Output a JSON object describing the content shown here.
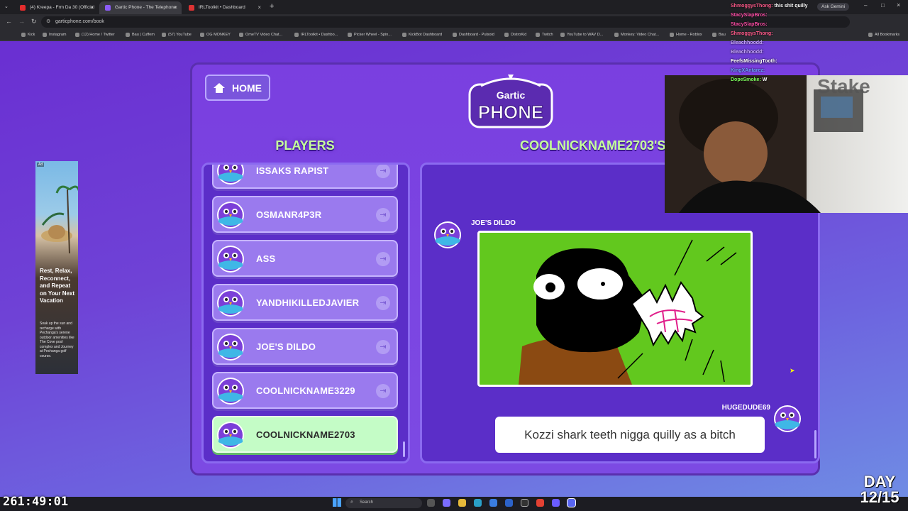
{
  "browser": {
    "tabs": [
      {
        "label": "(4) Kreepa - Frm Da 30 (Official",
        "active": false
      },
      {
        "label": "Gartic Phone - The Telephone",
        "active": true
      },
      {
        "label": "IRLToolkit • Dashboard",
        "active": false
      }
    ],
    "new_tab": "+",
    "url": "garticphone.com/book",
    "bookmarks": [
      "Kick",
      "Instagram",
      "(12) Home / Twitter",
      "Bau | Cuffem",
      "(57) YouTube",
      "OG MONKEY",
      "OmeTV Video Chat...",
      "IRLToolkit • Dashbo...",
      "Picker Wheel - Spin...",
      "KickBot Dashboard",
      "Dashboard - Pulsoid",
      "DistroKid",
      "Twitch",
      "YouTube to WAV D...",
      "Monkey: Video Chat...",
      "Home - Roblox",
      "Bau"
    ],
    "all_bookmarks": "All Bookmarks",
    "ask_gemini": "Ask Gemini"
  },
  "game": {
    "home_label": "HOME",
    "logo_top": "Gartic",
    "logo_bottom": "PHONE",
    "players_title": "PLAYERS",
    "album_title": "COOLNICKNAME2703'S",
    "players": [
      {
        "name": "ISSAKS RAPIST",
        "me": false
      },
      {
        "name": "OSMANR4P3R",
        "me": false
      },
      {
        "name": "ASS",
        "me": false
      },
      {
        "name": "YANDHIKILLEDJAVIER",
        "me": false
      },
      {
        "name": "JOE'S DILDO",
        "me": false
      },
      {
        "name": "COOLNICKNAME3229",
        "me": false
      },
      {
        "name": "COOLNICKNAME2703",
        "me": true
      }
    ],
    "drawing_author": "JOE'S DILDO",
    "guess_author": "HUGEDUDE69",
    "guess_text": "Kozzi shark teeth nigga quilly as a bitch"
  },
  "ad": {
    "label": "Ad",
    "headline": "Rest, Relax, Reconnect, and Repeat on Your Next Vacation",
    "body": "Soak up the sun and recharge with Pechanga's serene outdoor amenities like The Cove pool complex and Journey at Pechanga golf course."
  },
  "stream": {
    "chat": [
      {
        "user": "ShmoggysThong:",
        "text": "this shit quilly",
        "color": "#ff5a8a"
      },
      {
        "user": "StacySlapBros:",
        "text": "",
        "color": "#ff4da6"
      },
      {
        "user": "StacySlapBros:",
        "text": "",
        "color": "#ff4da6"
      },
      {
        "user": "ShmoggysThong:",
        "text": "",
        "color": "#ff5a8a"
      },
      {
        "user": "Bleachhoodd:",
        "text": "",
        "color": "#c9a8ff"
      },
      {
        "user": "Bleachhoodd:",
        "text": "",
        "color": "#c9a8ff"
      },
      {
        "user": "FeefsMissingTooth:",
        "text": "",
        "color": "#ffffff"
      },
      {
        "user": "KingXAntarez:",
        "text": "",
        "color": "#6aa0ff"
      },
      {
        "user": "DopeSmoke:",
        "text": "W",
        "color": "#7dff5c"
      }
    ],
    "timer": "261:49:01",
    "day": "DAY",
    "day_count": "12/15"
  },
  "taskbar": {
    "search_placeholder": "Search"
  },
  "colors": {
    "title_green": "#c5ff9b",
    "panel_purple": "#5b2ec8",
    "player_card": "#9a7aee",
    "me_card": "#c4fcc6",
    "canvas_green": "#62c81e"
  }
}
